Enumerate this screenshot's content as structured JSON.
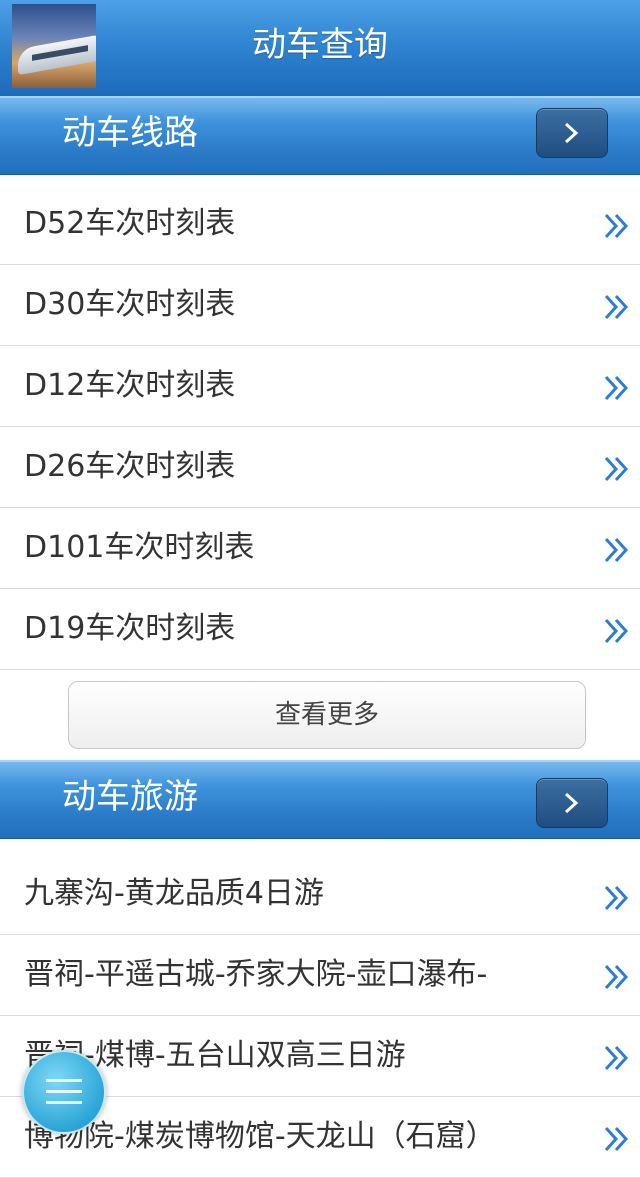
{
  "header": {
    "title": "动车查询"
  },
  "sections": [
    {
      "title": "动车线路"
    },
    {
      "title": "动车旅游"
    }
  ],
  "routes": [
    "D52车次时刻表",
    "D30车次时刻表",
    "D12车次时刻表",
    "D26车次时刻表",
    "D101车次时刻表",
    "D19车次时刻表"
  ],
  "more_label": "查看更多",
  "tours": [
    "九寨沟-黄龙品质4日游",
    "晋祠-平遥古城-乔家大院-壶口瀑布-",
    "晋祠-煤博-五台山双高三日游",
    "博物院-煤炭博物馆-天龙山（石窟）"
  ],
  "colors": {
    "header_blue": "#2f83d0",
    "chevron_blue": "#2f7dd1"
  }
}
